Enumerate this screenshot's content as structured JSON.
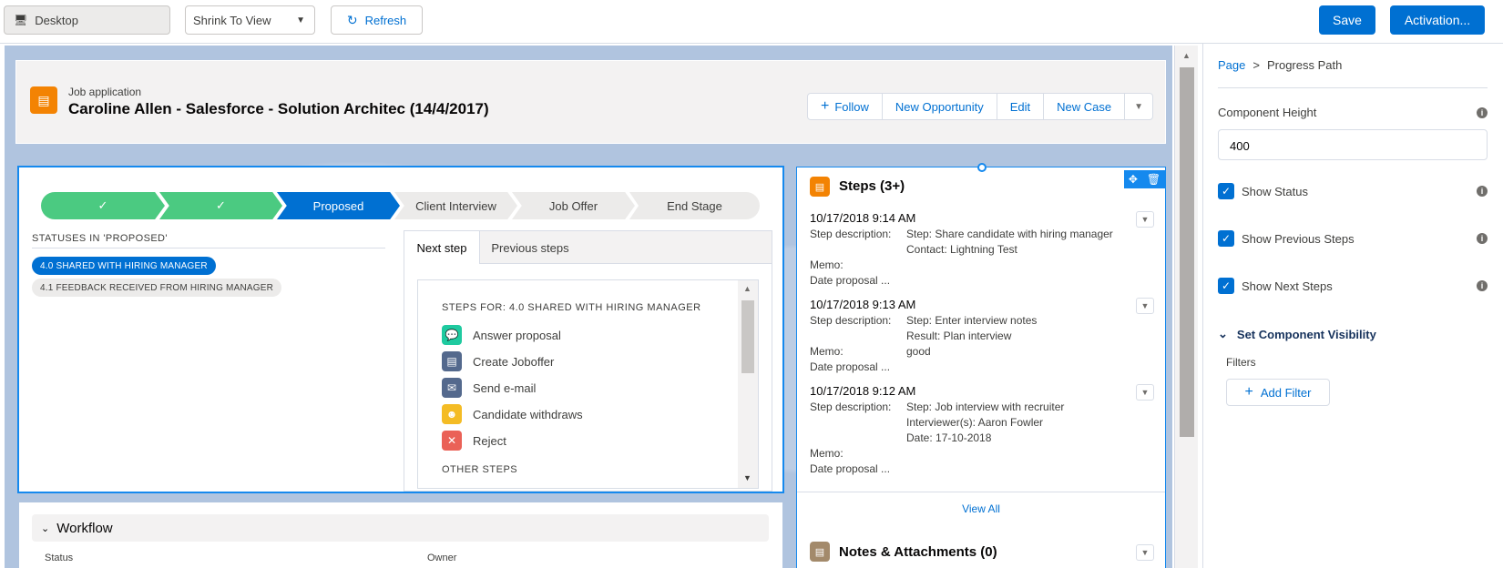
{
  "toolbar": {
    "device": "Desktop",
    "view_mode": "Shrink To View",
    "refresh": "Refresh",
    "save": "Save",
    "activation": "Activation..."
  },
  "record": {
    "object_type": "Job application",
    "title": "Caroline Allen - Salesforce - Solution Architec (14/4/2017)",
    "actions": [
      "Follow",
      "New Opportunity",
      "Edit",
      "New Case"
    ]
  },
  "path": {
    "stages": [
      {
        "label": "✓",
        "state": "complete"
      },
      {
        "label": "✓",
        "state": "complete"
      },
      {
        "label": "Proposed",
        "state": "current"
      },
      {
        "label": "Client Interview",
        "state": "incomplete"
      },
      {
        "label": "Job Offer",
        "state": "incomplete"
      },
      {
        "label": "End Stage",
        "state": "incomplete"
      }
    ],
    "statuses_header": "STATUSES IN 'PROPOSED'",
    "statuses": [
      {
        "label": "4.0 SHARED WITH HIRING MANAGER",
        "active": true
      },
      {
        "label": "4.1 FEEDBACK RECEIVED FROM HIRING MANAGER",
        "active": false
      }
    ],
    "tabs": [
      "Next step",
      "Previous steps"
    ],
    "steps_header": "STEPS FOR: 4.0 SHARED WITH HIRING MANAGER",
    "steps": [
      {
        "label": "Answer proposal",
        "icon": "chat-icon",
        "color": "#1fcaa0"
      },
      {
        "label": "Create Joboffer",
        "icon": "document-icon",
        "color": "#54698d"
      },
      {
        "label": "Send e-mail",
        "icon": "email-icon",
        "color": "#54698d"
      },
      {
        "label": "Candidate withdraws",
        "icon": "user-icon",
        "color": "#f4bc25"
      },
      {
        "label": "Reject",
        "icon": "close-icon",
        "color": "#ea6157"
      }
    ],
    "other_steps": "OTHER STEPS"
  },
  "steps_card": {
    "title": "Steps (3+)",
    "entries": [
      {
        "date": "10/17/2018 9:14 AM",
        "desc_label": "Step description:",
        "desc_lines": [
          "Step: Share candidate with hiring manager",
          "Contact: Lightning Test"
        ],
        "memo_label": "Memo:",
        "memo": "",
        "proposal_label": "Date proposal ..."
      },
      {
        "date": "10/17/2018 9:13 AM",
        "desc_label": "Step description:",
        "desc_lines": [
          "Step: Enter interview notes",
          "Result: Plan interview"
        ],
        "memo_label": "Memo:",
        "memo": "good",
        "proposal_label": "Date proposal ..."
      },
      {
        "date": "10/17/2018 9:12 AM",
        "desc_label": "Step description:",
        "desc_lines": [
          "Step: Job interview with recruiter",
          "Interviewer(s): Aaron Fowler",
          "Date: 17-10-2018"
        ],
        "memo_label": "Memo:",
        "memo": "",
        "proposal_label": "Date proposal ..."
      }
    ],
    "view_all": "View All"
  },
  "notes_card": {
    "title": "Notes & Attachments (0)"
  },
  "workflow": {
    "title": "Workflow",
    "col1": "Status",
    "col2": "Owner"
  },
  "panel": {
    "breadcrumb_root": "Page",
    "breadcrumb_sep": ">",
    "breadcrumb_current": "Progress Path",
    "height_label": "Component Height",
    "height_value": "400",
    "checks": [
      "Show Status",
      "Show Previous Steps",
      "Show Next Steps"
    ],
    "visibility_title": "Set Component Visibility",
    "filters_label": "Filters",
    "add_filter": "Add Filter"
  },
  "colors": {
    "brand": "#0070d2",
    "complete": "#4bca81",
    "current": "#0070d2",
    "incomplete": "#ecebea"
  }
}
